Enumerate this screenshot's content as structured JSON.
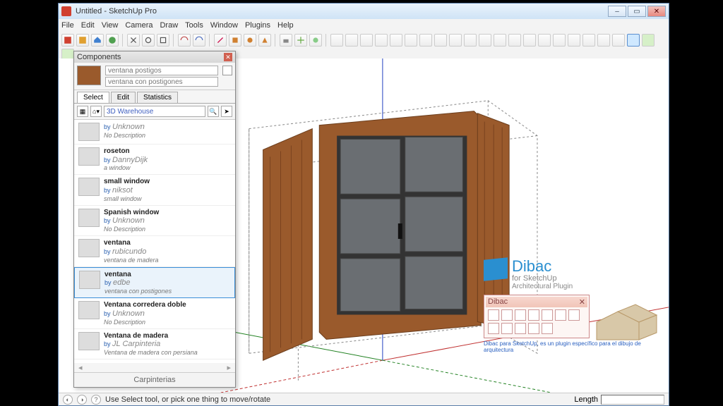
{
  "window": {
    "title": "Untitled - SketchUp Pro",
    "controls": {
      "min": "–",
      "max": "▭",
      "close": "✕"
    }
  },
  "menu": [
    "File",
    "Edit",
    "View",
    "Camera",
    "Draw",
    "Tools",
    "Window",
    "Plugins",
    "Help"
  ],
  "components_panel": {
    "title": "Components",
    "search_placeholder": "ventana postigos",
    "name_value": "ventana con postigones",
    "tabs": [
      "Select",
      "Edit",
      "Statistics"
    ],
    "active_tab": 0,
    "source": "3D Warehouse",
    "results": [
      {
        "name": "",
        "author": "Unknown",
        "desc": "No Description"
      },
      {
        "name": "roseton",
        "author": "DannyDijk",
        "desc": "a window"
      },
      {
        "name": "small window",
        "author": "niksot",
        "desc": "small window"
      },
      {
        "name": "Spanish window",
        "author": "Unknown",
        "desc": "No Description"
      },
      {
        "name": "ventana",
        "author": "rubicundo",
        "desc": "ventana de madera"
      },
      {
        "name": "ventana",
        "author": "edbe",
        "desc": "ventana con postigones",
        "selected": true
      },
      {
        "name": "Ventana corredera doble",
        "author": "Unknown",
        "desc": "No Description"
      },
      {
        "name": "Ventana de madera",
        "author": "JL Carpinteria",
        "desc": "Ventana de madera con persiana"
      }
    ],
    "collection": "Carpinterias"
  },
  "statusbar": {
    "hint": "Use Select tool, or pick one thing to move/rotate",
    "length_label": "Length",
    "length_value": ""
  },
  "dibac": {
    "brand": "Dibac",
    "sub1": "for SketchUp",
    "sub2": "Architectural Plugin",
    "panel_title": "Dibac",
    "footer": "Dibac para SketchUp, es un plugin específico para el dibujo de arquitectura"
  },
  "by_label": "by "
}
